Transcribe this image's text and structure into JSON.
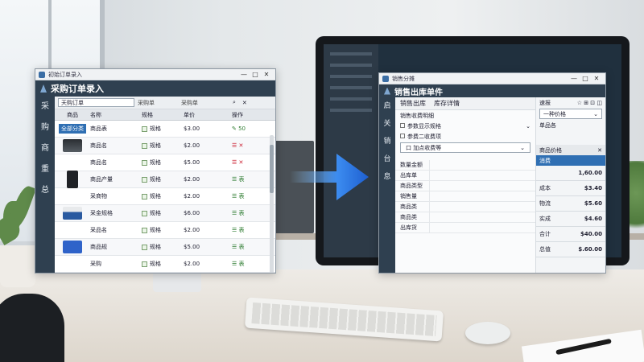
{
  "windowA": {
    "titlebar_title": "初始订单录入",
    "header_title": "采购订单录入",
    "controls": [
      "—",
      "□",
      "✕"
    ],
    "nav": [
      "采",
      "购",
      "商",
      "重",
      "总"
    ],
    "toolbar": {
      "search_value": "天购订单",
      "label1": "采购单",
      "label2": "采购单",
      "icon": "⌕",
      "close": "✕"
    },
    "columns": [
      "商品",
      "名称",
      "规格",
      "单价",
      "操作"
    ],
    "rows": [
      {
        "badge": "全部分类",
        "name": "商品表",
        "spec": "规格",
        "price": "$3.00",
        "act": "✎ 50",
        "thumb": ""
      },
      {
        "badge": "",
        "name": "商品名",
        "spec": "规格",
        "price": "$2.00",
        "act": "☰ ✕",
        "thumb": "th-printer"
      },
      {
        "badge": "",
        "name": "商品名",
        "spec": "规格",
        "price": "$5.00",
        "act": "☰ ✕",
        "thumb": ""
      },
      {
        "badge": "",
        "name": "商品产量",
        "spec": "规格",
        "price": "$2.00",
        "act": "☰ 表",
        "thumb": "th-box"
      },
      {
        "badge": "",
        "name": "采商物",
        "spec": "规格",
        "price": "$2.00",
        "act": "☰ 表",
        "thumb": ""
      },
      {
        "badge": "",
        "name": "采金规格",
        "spec": "规格",
        "price": "$6.00",
        "act": "☰ 表",
        "thumb": "th-scale"
      },
      {
        "badge": "",
        "name": "采品名",
        "spec": "规格",
        "price": "$2.00",
        "act": "☰ 表",
        "thumb": ""
      },
      {
        "badge": "",
        "name": "商品规",
        "spec": "规格",
        "price": "$5.00",
        "act": "☰ 表",
        "thumb": "th-blue"
      },
      {
        "badge": "",
        "name": "采购",
        "spec": "规格",
        "price": "$2.00",
        "act": "☰ 表",
        "thumb": ""
      }
    ]
  },
  "windowB": {
    "titlebar_title": "销售分摊",
    "header_title": "销售出库单件",
    "controls": [
      "—",
      "□",
      "✕"
    ],
    "nav": [
      "启",
      "关",
      "销",
      "台",
      "息"
    ],
    "tabs": [
      "销售出库",
      "库存详情"
    ],
    "sections": [
      "销售收费明细",
      "参数显示规格",
      "参费二收费项",
      "口 加点收费等"
    ],
    "fields": [
      "数量金额",
      "出库单",
      "商品类型",
      "销售量",
      "商品类",
      "商品类",
      "出库货"
    ],
    "side": {
      "top": [
        "速报",
        "☆ ⊞ ⊡ ◫"
      ],
      "items": [
        "一种价格",
        "单品各",
        "商品价格"
      ],
      "pick_label": "商品价格",
      "pick_close": "✕",
      "selected": "消费",
      "totals": [
        {
          "label": "",
          "value": "1,60.00"
        },
        {
          "label": "成本",
          "value": "$3.40"
        },
        {
          "label": "物流",
          "value": "$5.60"
        },
        {
          "label": "实成",
          "value": "$4.60"
        },
        {
          "label": "合计",
          "value": "$40.00"
        },
        {
          "label": "总值",
          "value": "$.60.00"
        }
      ]
    }
  }
}
